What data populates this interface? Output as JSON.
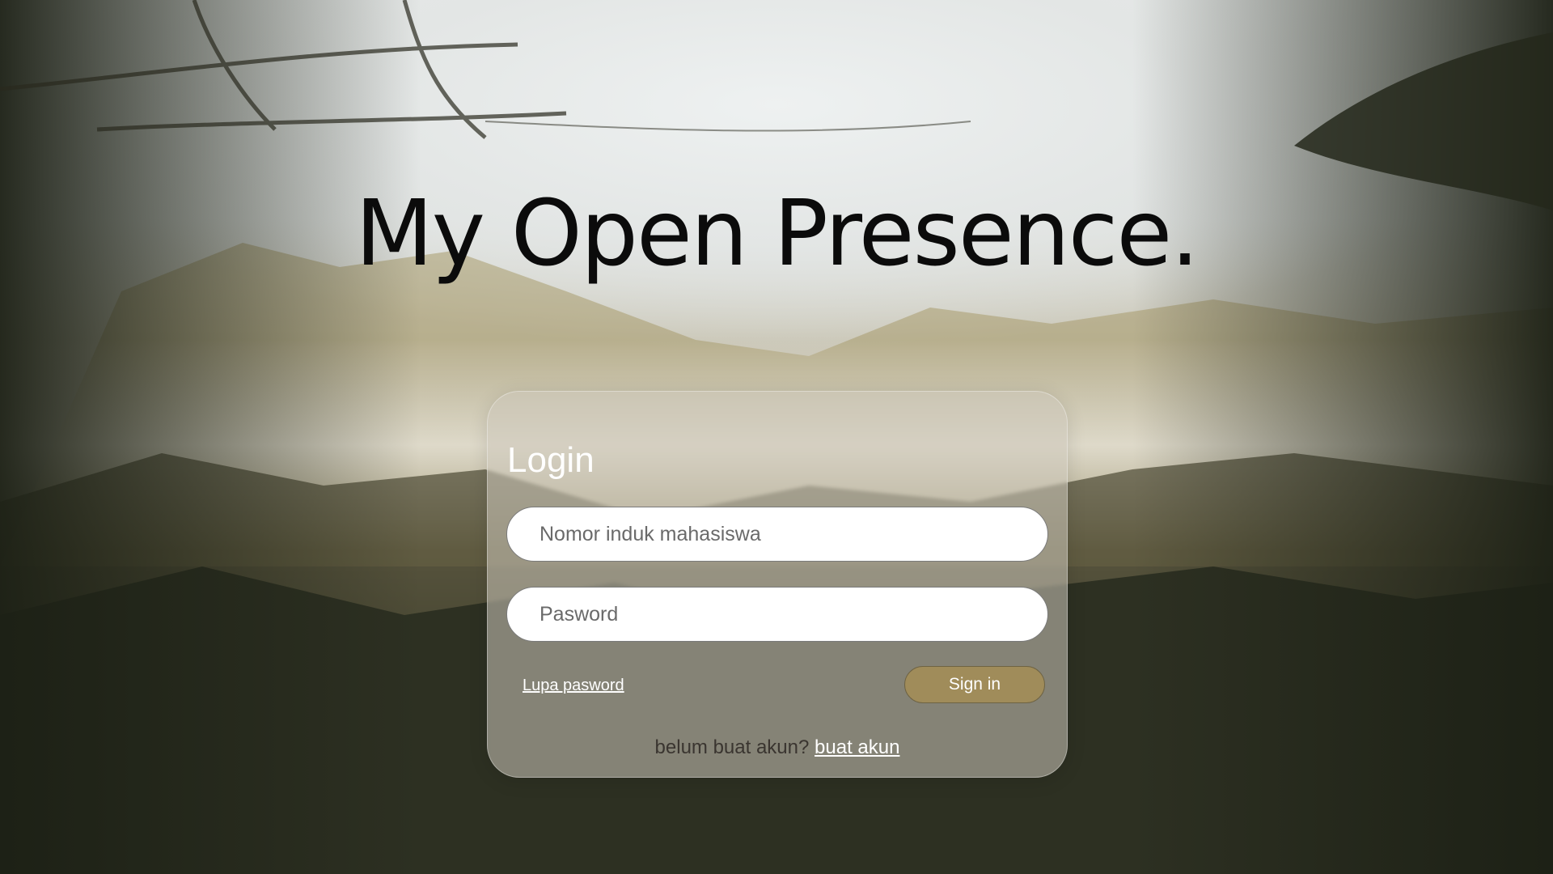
{
  "page": {
    "title": "My Open Presence."
  },
  "login": {
    "heading": "Login",
    "nim_placeholder": "Nomor induk mahasiswa",
    "password_placeholder": "Pasword",
    "forgot_label": "Lupa pasword",
    "signin_label": "Sign in",
    "register_prompt": "belum buat akun?",
    "register_link": "buat akun"
  },
  "colors": {
    "signin_button": "#a08c5a",
    "card_background": "rgba(205,200,188,0.55)",
    "title_text": "#0b0b0b"
  }
}
